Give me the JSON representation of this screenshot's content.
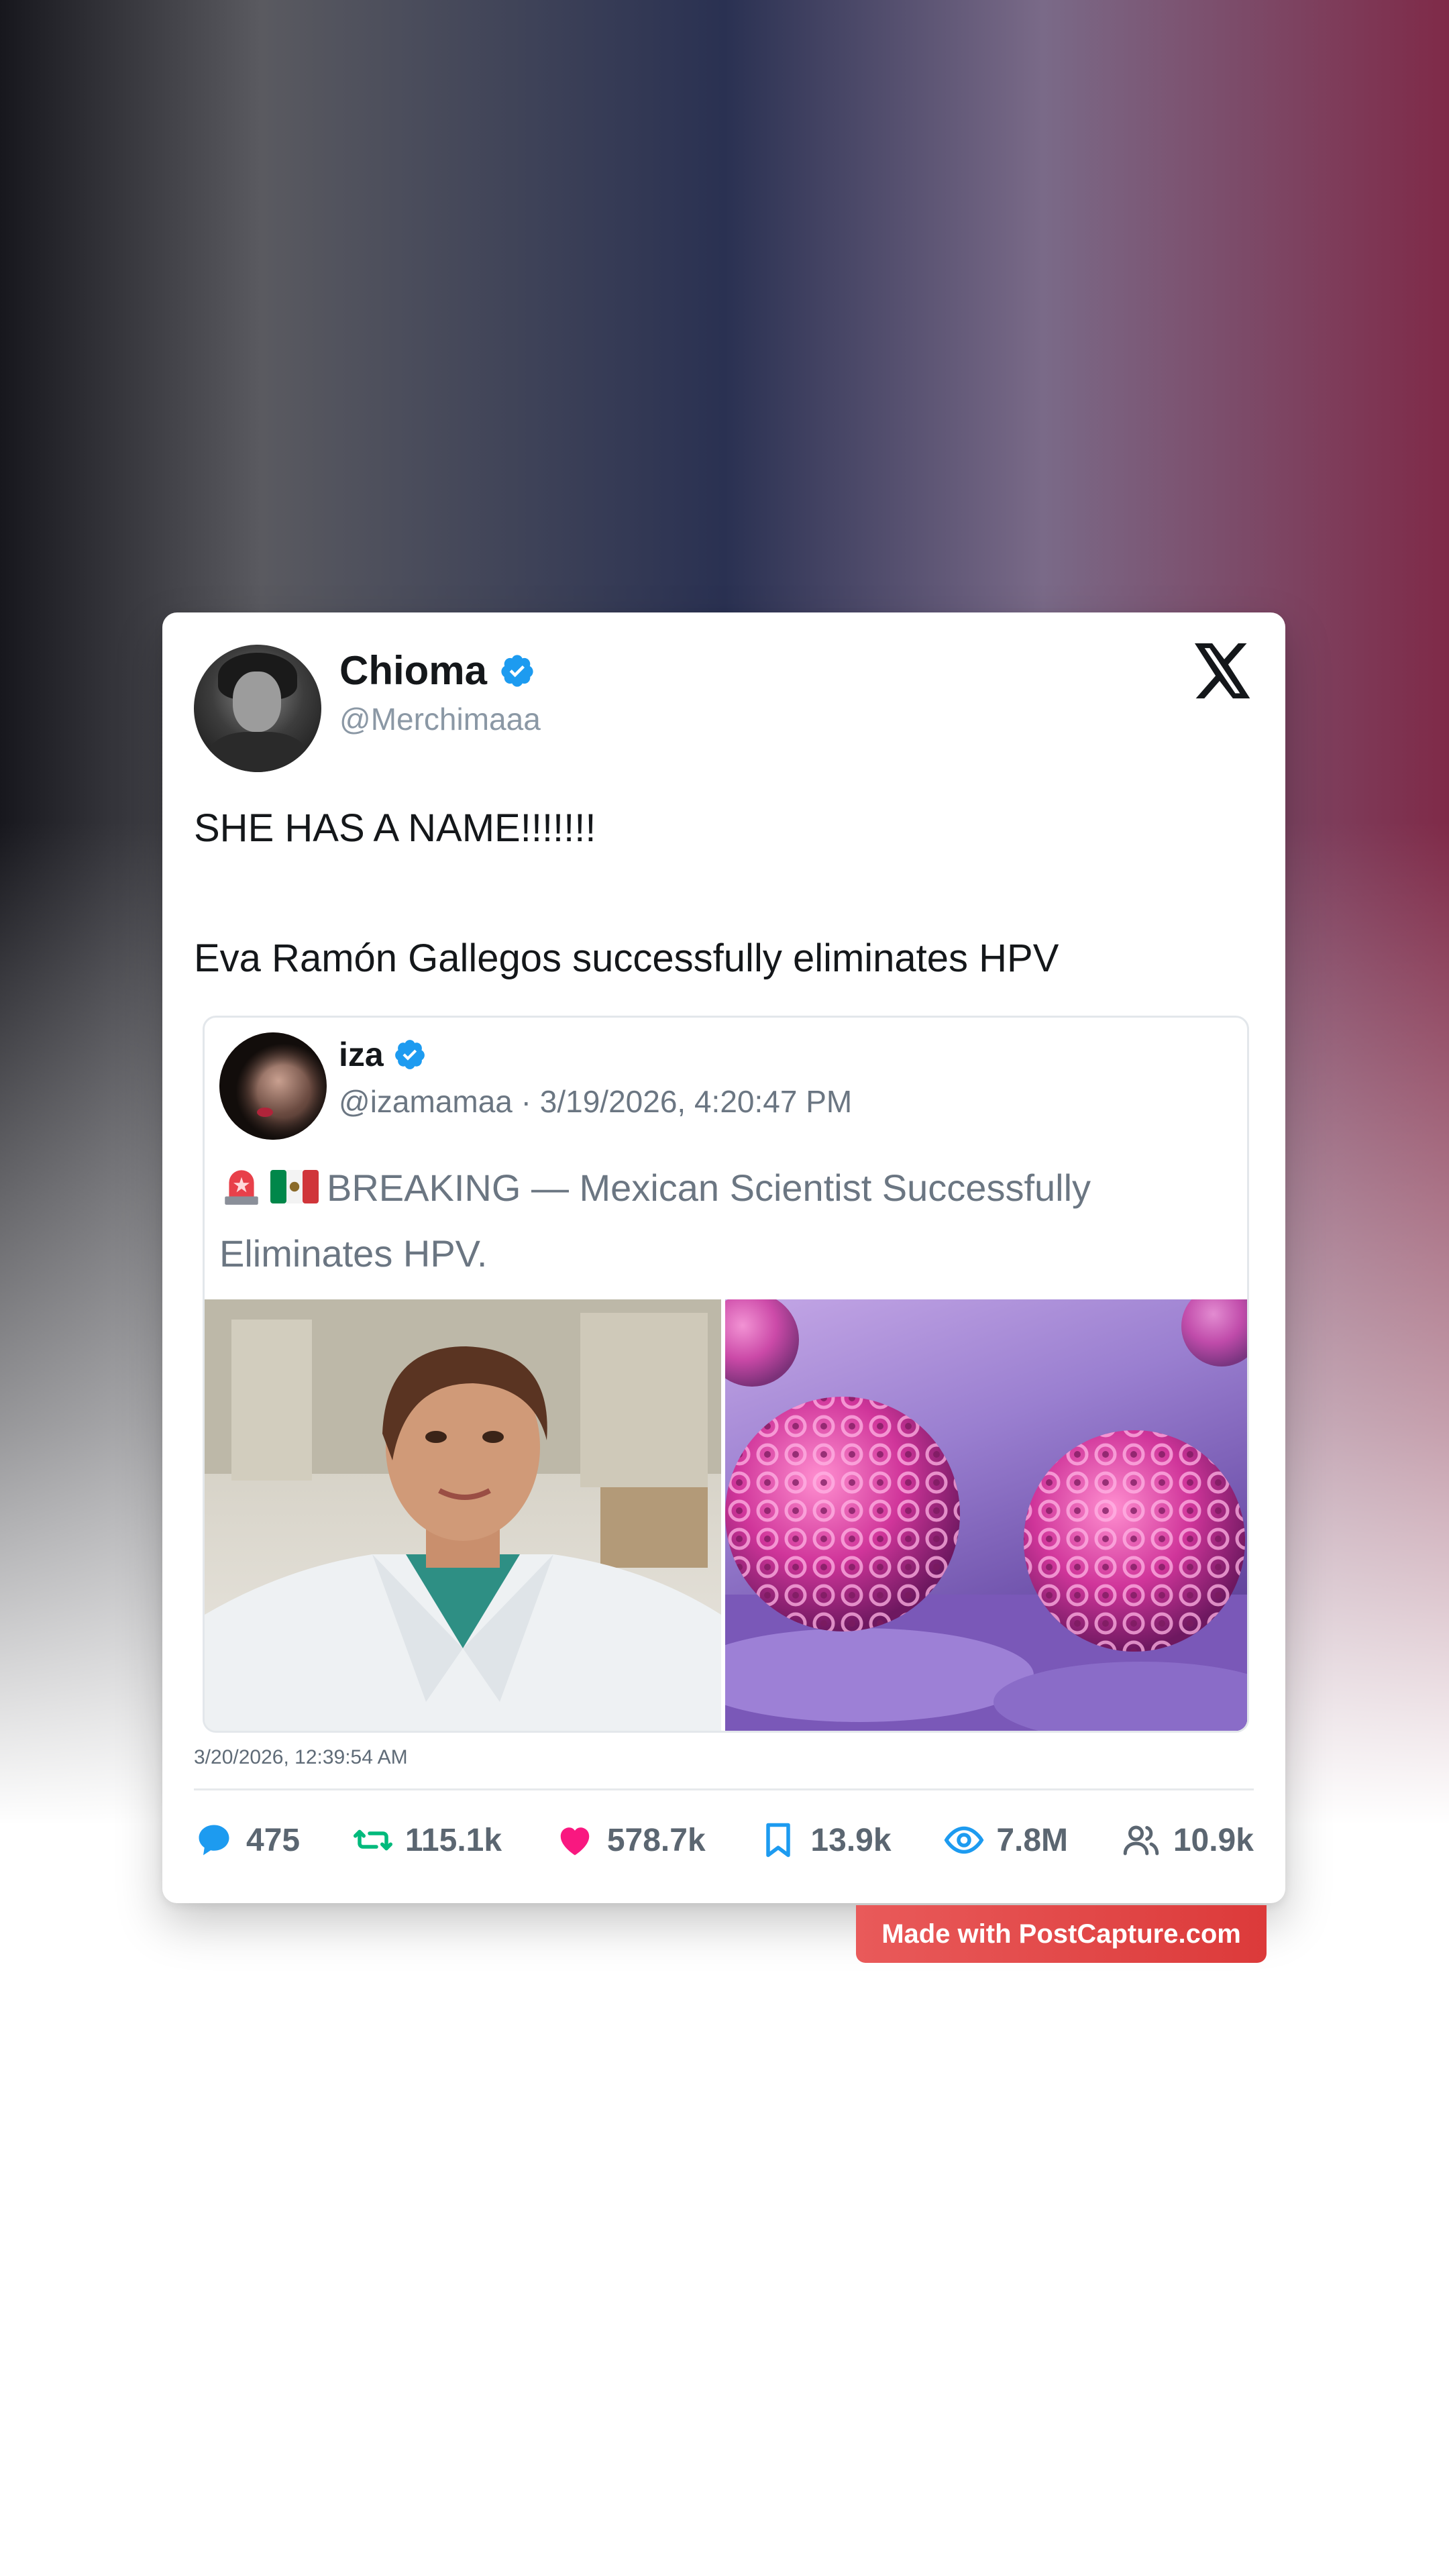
{
  "post": {
    "author_name": "Chioma",
    "author_handle": "@Merchimaaa",
    "text_line1": "SHE HAS A NAME!!!!!!!",
    "text_line2": "Eva Ramón Gallegos successfully eliminates HPV",
    "timestamp": "3/20/2026, 12:39:54 AM"
  },
  "quoted": {
    "author_name": "iza",
    "author_meta": "@izamamaa · 3/19/2026, 4:20:47 PM",
    "text": "BREAKING — Mexican Scientist Successfully Eliminates HPV."
  },
  "stats": {
    "replies": "475",
    "reposts": "115.1k",
    "likes": "578.7k",
    "bookmarks": "13.9k",
    "views": "7.8M",
    "followers": "10.9k"
  },
  "badge": {
    "text": "Made with PostCapture.com"
  },
  "colors": {
    "verified": "#1d9bf0",
    "reply": "#1d9bf0",
    "repost": "#00ba7c",
    "like": "#f91880",
    "bookmark": "#1d9bf0",
    "views": "#1d9bf0",
    "badge": "#e04545"
  },
  "icons": [
    "x-logo-icon",
    "verified-icon",
    "reply-icon",
    "repost-icon",
    "like-icon",
    "bookmark-icon",
    "views-icon",
    "followers-icon",
    "siren-emoji",
    "mexico-flag-emoji"
  ]
}
